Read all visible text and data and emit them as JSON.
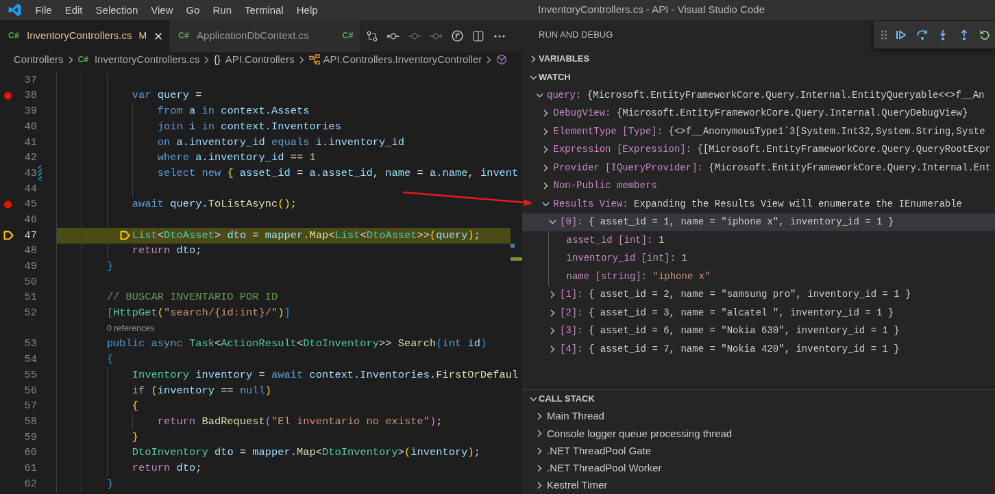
{
  "window": {
    "title": "InventoryControllers.cs - API - Visual Studio Code"
  },
  "menu": [
    "File",
    "Edit",
    "Selection",
    "View",
    "Go",
    "Run",
    "Terminal",
    "Help"
  ],
  "tabs": [
    {
      "icon": "C#",
      "label": "InventoryControllers.cs",
      "badge": "M",
      "modified": true,
      "selected": true
    },
    {
      "icon": "C#",
      "label": "ApplicationDbContext.cs",
      "modified": false,
      "selected": false
    },
    {
      "icon": "C#",
      "selected": false
    }
  ],
  "editor_actions": [
    {
      "kind": "compare",
      "disabled": false
    },
    {
      "kind": "previous",
      "disabled": false
    },
    {
      "kind": "current",
      "disabled": true
    },
    {
      "kind": "next",
      "disabled": true
    },
    {
      "kind": "branch",
      "disabled": false
    },
    {
      "kind": "split",
      "disabled": false
    },
    {
      "kind": "more",
      "disabled": false
    }
  ],
  "breadcrumbs": [
    {
      "kind": "folder",
      "label": "Controllers"
    },
    {
      "kind": "file",
      "icon": "C#",
      "label": "InventoryControllers.cs"
    },
    {
      "kind": "namespace",
      "icon": "{}",
      "label": "API.Controllers"
    },
    {
      "kind": "class",
      "label": "API.Controllers.InventoryController"
    },
    {
      "kind": "member"
    }
  ],
  "editor": {
    "lines": [
      {
        "kind": "code",
        "number": "37",
        "breakpoint": false,
        "current": false,
        "modified": false
      },
      {
        "kind": "code",
        "number": "38",
        "breakpoint": true,
        "current": false,
        "modified": false,
        "tokens": [
          {
            "text": "            var",
            "kind": "kw"
          },
          {
            "text": " query",
            "kind": "var"
          },
          {
            "text": " =",
            "kind": "op"
          }
        ]
      },
      {
        "kind": "code",
        "number": "39",
        "breakpoint": false,
        "current": false,
        "modified": false,
        "tokens": [
          {
            "text": "                from",
            "kind": "kw"
          },
          {
            "text": " a",
            "kind": "var"
          },
          {
            "text": " in",
            "kind": "kw"
          },
          {
            "text": " context.Assets",
            "kind": "var"
          }
        ]
      },
      {
        "kind": "code",
        "number": "40",
        "breakpoint": false,
        "current": false,
        "modified": false,
        "tokens": [
          {
            "text": "                join",
            "kind": "kw"
          },
          {
            "text": " i",
            "kind": "var"
          },
          {
            "text": " in",
            "kind": "kw"
          },
          {
            "text": " context.Inventories",
            "kind": "var"
          }
        ]
      },
      {
        "kind": "code",
        "number": "41",
        "breakpoint": false,
        "current": false,
        "modified": false,
        "tokens": [
          {
            "text": "                on",
            "kind": "kw"
          },
          {
            "text": " a.inventory_id",
            "kind": "var"
          },
          {
            "text": " equals",
            "kind": "kw"
          },
          {
            "text": " i.inventory_id",
            "kind": "var"
          }
        ]
      },
      {
        "kind": "code",
        "number": "42",
        "breakpoint": false,
        "current": false,
        "modified": false,
        "tokens": [
          {
            "text": "                where",
            "kind": "kw"
          },
          {
            "text": " a.inventory_id",
            "kind": "var"
          },
          {
            "text": " ==",
            "kind": "op"
          },
          {
            "text": " 1",
            "kind": "num"
          }
        ]
      },
      {
        "kind": "code",
        "number": "43",
        "breakpoint": false,
        "current": false,
        "modified": true,
        "tokens": [
          {
            "text": "                select",
            "kind": "kw"
          },
          {
            "text": " new",
            "kind": "kw"
          },
          {
            "text": " {",
            "kind": "b1"
          },
          {
            "text": " asset_id",
            "kind": "var"
          },
          {
            "text": " =",
            "kind": "op"
          },
          {
            "text": " a.asset_id",
            "kind": "var"
          },
          {
            "text": ",",
            "kind": "op"
          },
          {
            "text": " name",
            "kind": "var"
          },
          {
            "text": " =",
            "kind": "op"
          },
          {
            "text": " a.name",
            "kind": "var"
          },
          {
            "text": ",",
            "kind": "op"
          },
          {
            "text": " invent",
            "kind": "var"
          }
        ]
      },
      {
        "kind": "code",
        "number": "44",
        "breakpoint": false,
        "current": false,
        "modified": false
      },
      {
        "kind": "code",
        "number": "45",
        "breakpoint": true,
        "current": false,
        "modified": false,
        "tokens": [
          {
            "text": "            await",
            "kind": "kw"
          },
          {
            "text": " query",
            "kind": "var"
          },
          {
            "text": ".",
            "kind": "op"
          },
          {
            "text": "ToListAsync",
            "kind": "fn"
          },
          {
            "text": "()",
            "kind": "b1"
          },
          {
            "text": ";",
            "kind": "op"
          }
        ]
      },
      {
        "kind": "code",
        "number": "46",
        "breakpoint": false,
        "current": false,
        "modified": false
      },
      {
        "kind": "code",
        "number": "47",
        "breakpoint": false,
        "current": true,
        "modified": false,
        "tokens": [
          {
            "text": "            List",
            "kind": "type"
          },
          {
            "text": "<",
            "kind": "op"
          },
          {
            "text": "DtoAsset",
            "kind": "type"
          },
          {
            "text": ">",
            "kind": "op"
          },
          {
            "text": " dto",
            "kind": "var"
          },
          {
            "text": " =",
            "kind": "op"
          },
          {
            "text": " mapper",
            "kind": "var"
          },
          {
            "text": ".",
            "kind": "op"
          },
          {
            "text": "Map",
            "kind": "fn"
          },
          {
            "text": "<",
            "kind": "op"
          },
          {
            "text": "List",
            "kind": "type"
          },
          {
            "text": "<",
            "kind": "op"
          },
          {
            "text": "DtoAsset",
            "kind": "type"
          },
          {
            "text": ">>",
            "kind": "op"
          },
          {
            "text": "(",
            "kind": "b1"
          },
          {
            "text": "query",
            "kind": "var"
          },
          {
            "text": ")",
            "kind": "b1"
          },
          {
            "text": ";",
            "kind": "op"
          }
        ]
      },
      {
        "kind": "code",
        "number": "48",
        "breakpoint": false,
        "current": false,
        "modified": false,
        "tokens": [
          {
            "text": "            return",
            "kind": "ctl"
          },
          {
            "text": " dto",
            "kind": "var"
          },
          {
            "text": ";",
            "kind": "op"
          }
        ]
      },
      {
        "kind": "code",
        "number": "49",
        "breakpoint": false,
        "current": false,
        "modified": false,
        "tokens": [
          {
            "text": "        }",
            "kind": "b3"
          }
        ]
      },
      {
        "kind": "code",
        "number": "50",
        "breakpoint": false,
        "current": false,
        "modified": false
      },
      {
        "kind": "code",
        "number": "51",
        "breakpoint": false,
        "current": false,
        "modified": false,
        "tokens": [
          {
            "text": "        // BUSCAR INVENTARIO POR ID",
            "kind": "com"
          }
        ]
      },
      {
        "kind": "code",
        "number": "52",
        "breakpoint": false,
        "current": false,
        "modified": false,
        "tokens": [
          {
            "text": "        [",
            "kind": "b3"
          },
          {
            "text": "HttpGet",
            "kind": "type"
          },
          {
            "text": "(",
            "kind": "b1"
          },
          {
            "text": "\"search/{id:int}/\"",
            "kind": "str"
          },
          {
            "text": ")",
            "kind": "b1"
          },
          {
            "text": "]",
            "kind": "b3"
          }
        ]
      },
      {
        "kind": "codelens",
        "text": "0 references"
      },
      {
        "kind": "code",
        "number": "53",
        "breakpoint": false,
        "current": false,
        "modified": false,
        "tokens": [
          {
            "text": "        public",
            "kind": "kw"
          },
          {
            "text": " async",
            "kind": "kw"
          },
          {
            "text": " Task",
            "kind": "type"
          },
          {
            "text": "<",
            "kind": "op"
          },
          {
            "text": "ActionResult",
            "kind": "type"
          },
          {
            "text": "<",
            "kind": "op"
          },
          {
            "text": "DtoInventory",
            "kind": "type"
          },
          {
            "text": ">>",
            "kind": "op"
          },
          {
            "text": " Search",
            "kind": "fn"
          },
          {
            "text": "(",
            "kind": "b3"
          },
          {
            "text": "int",
            "kind": "kw"
          },
          {
            "text": " id",
            "kind": "var"
          },
          {
            "text": ")",
            "kind": "b3"
          }
        ]
      },
      {
        "kind": "code",
        "number": "54",
        "breakpoint": false,
        "current": false,
        "modified": false,
        "tokens": [
          {
            "text": "        {",
            "kind": "b3"
          }
        ]
      },
      {
        "kind": "code",
        "number": "55",
        "breakpoint": false,
        "current": false,
        "modified": false,
        "tokens": [
          {
            "text": "            Inventory",
            "kind": "type"
          },
          {
            "text": " inventory",
            "kind": "var"
          },
          {
            "text": " =",
            "kind": "op"
          },
          {
            "text": " await",
            "kind": "kw"
          },
          {
            "text": " context.Inventories",
            "kind": "var"
          },
          {
            "text": ".",
            "kind": "op"
          },
          {
            "text": "FirstOrDefaul",
            "kind": "fn"
          }
        ]
      },
      {
        "kind": "code",
        "number": "56",
        "breakpoint": false,
        "current": false,
        "modified": false,
        "tokens": [
          {
            "text": "            if",
            "kind": "ctl"
          },
          {
            "text": " (",
            "kind": "b1"
          },
          {
            "text": "inventory",
            "kind": "var"
          },
          {
            "text": " ==",
            "kind": "op"
          },
          {
            "text": " null",
            "kind": "kw"
          },
          {
            "text": ")",
            "kind": "b1"
          }
        ]
      },
      {
        "kind": "code",
        "number": "57",
        "breakpoint": false,
        "current": false,
        "modified": false,
        "tokens": [
          {
            "text": "            {",
            "kind": "b1"
          }
        ]
      },
      {
        "kind": "code",
        "number": "58",
        "breakpoint": false,
        "current": false,
        "modified": false,
        "tokens": [
          {
            "text": "                return",
            "kind": "ctl"
          },
          {
            "text": " BadRequest",
            "kind": "fn"
          },
          {
            "text": "(",
            "kind": "b2"
          },
          {
            "text": "\"El inventario no existe\"",
            "kind": "str"
          },
          {
            "text": ")",
            "kind": "b2"
          },
          {
            "text": ";",
            "kind": "op"
          }
        ]
      },
      {
        "kind": "code",
        "number": "59",
        "breakpoint": false,
        "current": false,
        "modified": false,
        "tokens": [
          {
            "text": "            }",
            "kind": "b1"
          }
        ]
      },
      {
        "kind": "code",
        "number": "60",
        "breakpoint": false,
        "current": false,
        "modified": false,
        "tokens": [
          {
            "text": "            DtoInventory",
            "kind": "type"
          },
          {
            "text": " dto",
            "kind": "var"
          },
          {
            "text": " =",
            "kind": "op"
          },
          {
            "text": " mapper",
            "kind": "var"
          },
          {
            "text": ".",
            "kind": "op"
          },
          {
            "text": "Map",
            "kind": "fn"
          },
          {
            "text": "<",
            "kind": "op"
          },
          {
            "text": "DtoInventory",
            "kind": "type"
          },
          {
            "text": ">",
            "kind": "op"
          },
          {
            "text": "(",
            "kind": "b1"
          },
          {
            "text": "inventory",
            "kind": "var"
          },
          {
            "text": ")",
            "kind": "b1"
          },
          {
            "text": ";",
            "kind": "op"
          }
        ]
      },
      {
        "kind": "code",
        "number": "61",
        "breakpoint": false,
        "current": false,
        "modified": false,
        "tokens": [
          {
            "text": "            return",
            "kind": "ctl"
          },
          {
            "text": " dto",
            "kind": "var"
          },
          {
            "text": ";",
            "kind": "op"
          }
        ]
      },
      {
        "kind": "code",
        "number": "62",
        "breakpoint": false,
        "current": false,
        "modified": false,
        "tokens": [
          {
            "text": "        }",
            "kind": "b3"
          }
        ]
      }
    ]
  },
  "debug": {
    "title": "RUN AND DEBUG",
    "sections": [
      {
        "kind": "variables",
        "title": "VARIABLES",
        "expanded": false
      },
      {
        "kind": "watch",
        "title": "WATCH",
        "expanded": true,
        "items": [
          {
            "label": "query:",
            "value": "{Microsoft.EntityFrameworkCore.Query.Internal.EntityQueryable<<>f__An",
            "kind": "object",
            "expanded": true,
            "selected": false,
            "children": [
              {
                "label": "DebugView:",
                "value": "{Microsoft.EntityFrameworkCore.Query.Internal.QueryDebugView}",
                "kind": "object",
                "expanded": false,
                "selected": false
              },
              {
                "label": "ElementType [Type]:",
                "value": "{<>f__AnonymousType1`3[System.Int32,System.String,Syste",
                "kind": "object",
                "expanded": false,
                "selected": false
              },
              {
                "label": "Expression [Expression]:",
                "value": "{[Microsoft.EntityFrameworkCore.Query.QueryRootExpr",
                "kind": "object",
                "expanded": false,
                "selected": false
              },
              {
                "label": "Provider [IQueryProvider]:",
                "value": "{Microsoft.EntityFrameworkCore.Query.Internal.Ent",
                "kind": "object",
                "expanded": false,
                "selected": false
              },
              {
                "label": "Non-Public members",
                "expanded": false,
                "selected": false
              },
              {
                "label": "Results View:",
                "value": "Expanding the Results View will enumerate the IEnumerable",
                "kind": "object",
                "expanded": true,
                "selected": false,
                "children": [
                  {
                    "label": "[0]:",
                    "value": "{ asset_id = 1, name = \"iphone x\", inventory_id = 1 }",
                    "kind": "object",
                    "expanded": true,
                    "selected": true,
                    "children": [
                      {
                        "label": "asset_id [int]:",
                        "value": "1",
                        "kind": "number",
                        "selected": false
                      },
                      {
                        "label": "inventory_id [int]:",
                        "value": "1",
                        "kind": "number",
                        "selected": false
                      },
                      {
                        "label": "name [string]:",
                        "value": "\"iphone x\"",
                        "kind": "string",
                        "selected": false
                      }
                    ]
                  },
                  {
                    "label": "[1]:",
                    "value": "{ asset_id = 2, name = \"samsung pro\", inventory_id = 1 }",
                    "kind": "object",
                    "expanded": false,
                    "selected": false
                  },
                  {
                    "label": "[2]:",
                    "value": "{ asset_id = 3, name = \"alcatel \", inventory_id = 1 }",
                    "kind": "object",
                    "expanded": false,
                    "selected": false
                  },
                  {
                    "label": "[3]:",
                    "value": "{ asset_id = 6, name = \"Nokia 630\", inventory_id = 1 }",
                    "kind": "object",
                    "expanded": false,
                    "selected": false
                  },
                  {
                    "label": "[4]:",
                    "value": "{ asset_id = 7, name = \"Nokia 420\", inventory_id = 1 }",
                    "kind": "object",
                    "expanded": false,
                    "selected": false
                  }
                ]
              }
            ]
          }
        ]
      },
      {
        "kind": "call_stack",
        "title": "CALL STACK",
        "expanded": true,
        "items": [
          {
            "label": "Main Thread",
            "expanded": false,
            "selected": false
          },
          {
            "label": "Console logger queue processing thread",
            "expanded": false,
            "selected": false
          },
          {
            "label": ".NET ThreadPool Gate",
            "expanded": false,
            "selected": false
          },
          {
            "label": ".NET ThreadPool Worker",
            "expanded": false,
            "selected": false
          },
          {
            "label": "Kestrel Timer",
            "expanded": false,
            "selected": false
          }
        ]
      }
    ]
  }
}
